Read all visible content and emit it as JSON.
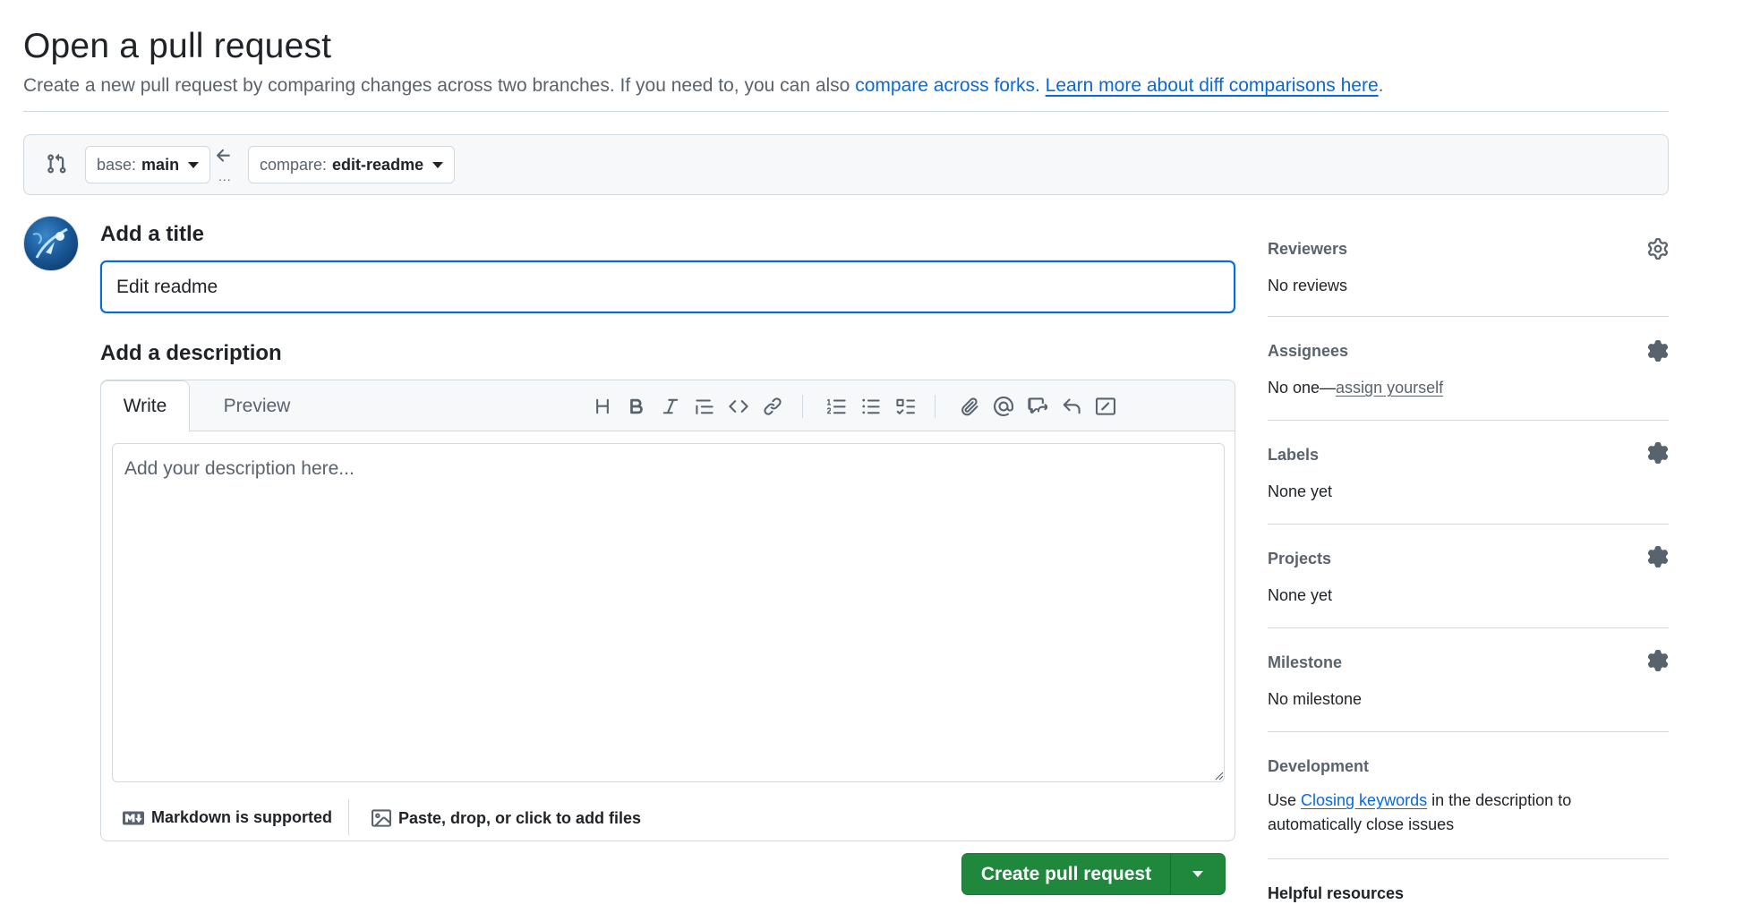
{
  "header": {
    "title": "Open a pull request",
    "subtitle_text": "Create a new pull request by comparing changes across two branches. If you need to, you can also",
    "compare_forks_link": "compare across forks.",
    "learn_more_link": "Learn more about diff comparisons here",
    "subtitle_end": "."
  },
  "range": {
    "base_label": "base:",
    "base_branch": "main",
    "arrow_dots": "...",
    "compare_label": "compare:",
    "compare_branch": "edit-readme"
  },
  "form": {
    "title_heading": "Add a title",
    "title_value": "Edit readme",
    "description_heading": "Add a description",
    "tabs": {
      "write": "Write",
      "preview": "Preview"
    },
    "description_placeholder": "Add your description here...",
    "markdown_note": "Markdown is supported",
    "paste_note": "Paste, drop, or click to add files",
    "create_button": "Create pull request"
  },
  "toolbar_icons": [
    "heading-icon",
    "bold-icon",
    "italic-icon",
    "quote-icon",
    "code-icon",
    "link-icon",
    "ordered-list-icon",
    "unordered-list-icon",
    "task-list-icon",
    "attach-icon",
    "mention-icon",
    "cross-reference-icon",
    "saved-replies-icon",
    "slash-commands-icon"
  ],
  "sidebar": {
    "reviewers": {
      "heading": "Reviewers",
      "value": "No reviews"
    },
    "assignees": {
      "heading": "Assignees",
      "value_prefix": "No one—",
      "value_link": "assign yourself"
    },
    "labels": {
      "heading": "Labels",
      "value": "None yet"
    },
    "projects": {
      "heading": "Projects",
      "value": "None yet"
    },
    "milestone": {
      "heading": "Milestone",
      "value": "No milestone"
    },
    "development": {
      "heading": "Development",
      "prefix": "Use",
      "link": "Closing keywords",
      "suffix": "in the description to automatically close issues"
    },
    "helpful": {
      "heading": "Helpful resources"
    }
  },
  "colors": {
    "accent": "#0969da",
    "primary_button": "#1f883d",
    "border": "#d1d9e0",
    "muted_text": "#59636e"
  }
}
